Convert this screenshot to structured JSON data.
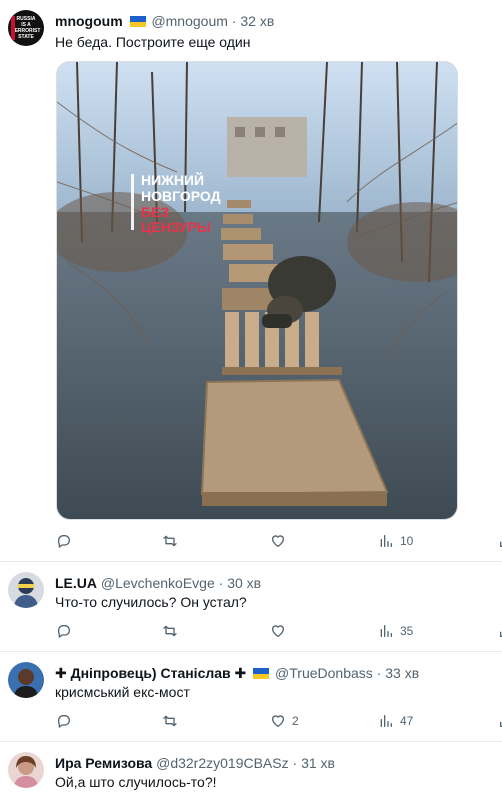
{
  "tweets": [
    {
      "name": "mnogoum",
      "handle": "@mnogoum",
      "time": "32 хв",
      "text": "Не беда. Построите еще один",
      "avatar_text": [
        "RUSSIA",
        "IS A",
        "TERRORIST",
        "STATE"
      ],
      "media_watermark": [
        "НИЖНИЙ",
        "НОВГОРОД",
        "БЕЗ",
        "ЦЕНЗУРЫ"
      ],
      "stats": {
        "replies": "",
        "retweets": "",
        "likes": "",
        "views": "10"
      }
    },
    {
      "name": "LE.UA",
      "handle": "@LevchenkoEvge",
      "time": "30 хв",
      "text": "Что-то случилось? Он устал?",
      "stats": {
        "replies": "",
        "retweets": "",
        "likes": "",
        "views": "35"
      }
    },
    {
      "name": "✚ Дніпровець) Станіслав ✚",
      "handle": "@TrueDonbass",
      "time": "33 хв",
      "text": "крисмський екс-мост",
      "stats": {
        "replies": "",
        "retweets": "",
        "likes": "2",
        "views": "47"
      }
    },
    {
      "name": "Ира Ремизова",
      "handle": "@d32r2zy019CBASz",
      "time": "31 хв",
      "text": "Ой,а што случилось-то?!"
    }
  ],
  "separator": "·",
  "colors": {
    "text": "#0f1419",
    "secondary": "#536471",
    "divider": "#e6ecf0",
    "flag_blue": "#1d60c9",
    "flag_yellow": "#f5c922",
    "watermark_red": "#e8334a"
  },
  "icons": {
    "reply": "reply-icon",
    "retweet": "retweet-icon",
    "like": "heart-icon",
    "views": "views-icon",
    "share": "share-icon"
  }
}
